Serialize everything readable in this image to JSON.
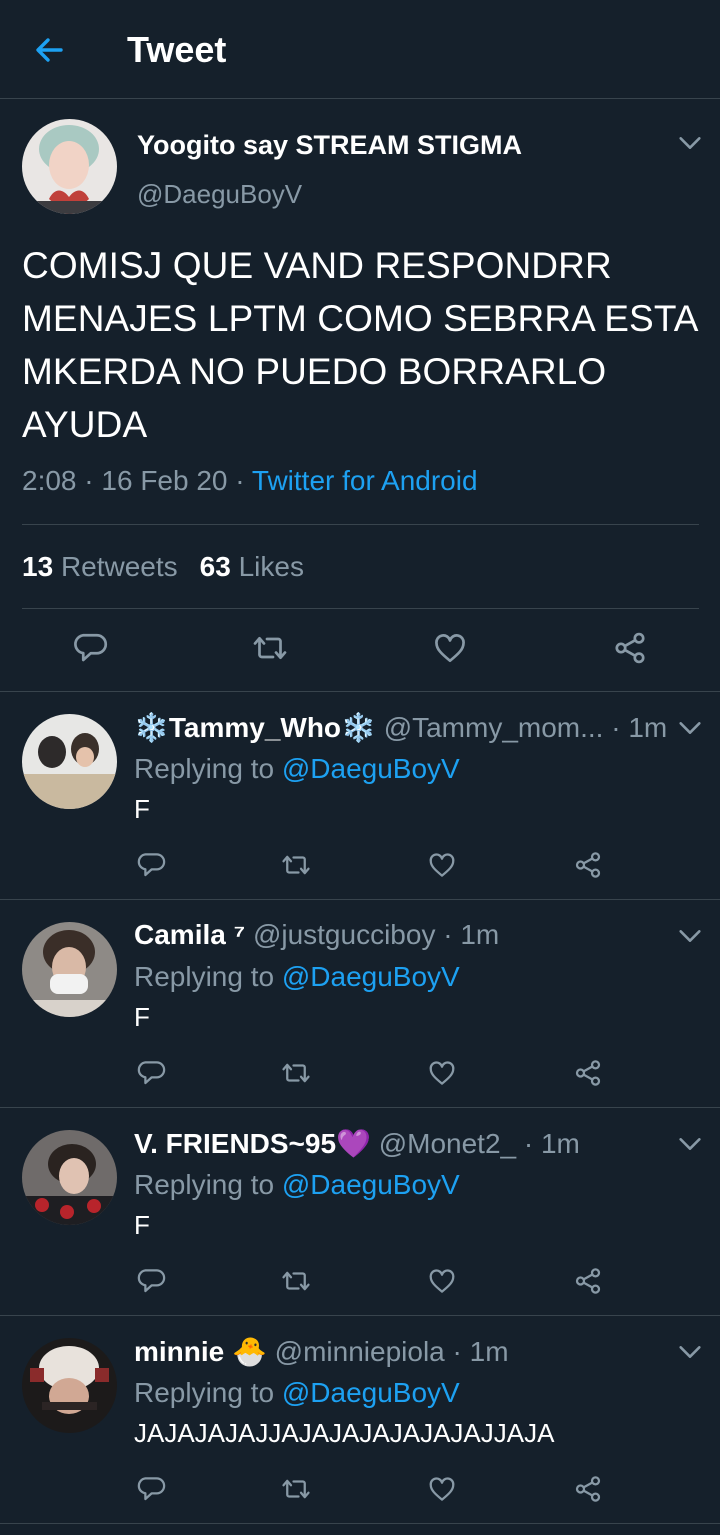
{
  "header": {
    "title": "Tweet",
    "back_icon": "arrow-left-icon",
    "accent": "#1da1f2"
  },
  "tweet": {
    "display_name": "Yoogito say STREAM STIGMA",
    "handle": "@DaeguBoyV",
    "text": "COMISJ QUE VAND RESPONDRR MENAJES LPTM COMO SEBRRA ESTA MKERDA NO PUEDO BORRARLO AYUDA",
    "time": "2:08",
    "date": "16 Feb 20",
    "separator": "·",
    "source": "Twitter for Android",
    "retweets_count": "13",
    "retweets_label": "Retweets",
    "likes_count": "63",
    "likes_label": "Likes"
  },
  "replies": [
    {
      "display_name": "❄️Tammy_Who❄️",
      "handle": "@Tammy_mom... · 1m",
      "replying_label": "Replying to",
      "replying_to": "@DaeguBoyV",
      "text": "F"
    },
    {
      "display_name": "Camila ⁷",
      "handle": "@justgucciboy · 1m",
      "replying_label": "Replying to",
      "replying_to": "@DaeguBoyV",
      "text": "F"
    },
    {
      "display_name": "V. FRIENDS~95💜",
      "handle": "@Monet2_ · 1m",
      "replying_label": "Replying to",
      "replying_to": "@DaeguBoyV",
      "text": "F"
    },
    {
      "display_name": "minnie 🐣",
      "handle": "@minniepiola · 1m",
      "replying_label": "Replying to",
      "replying_to": "@DaeguBoyV",
      "text": "JAJAJAJAJJAJAJAJAJAJAJAJJAJA"
    }
  ],
  "colors": {
    "background": "#15202b",
    "border": "#38444d",
    "secondary_text": "#8899a6",
    "link": "#1da1f2"
  },
  "icons": [
    "reply-icon",
    "retweet-icon",
    "like-icon",
    "share-icon",
    "chevron-down-icon"
  ]
}
